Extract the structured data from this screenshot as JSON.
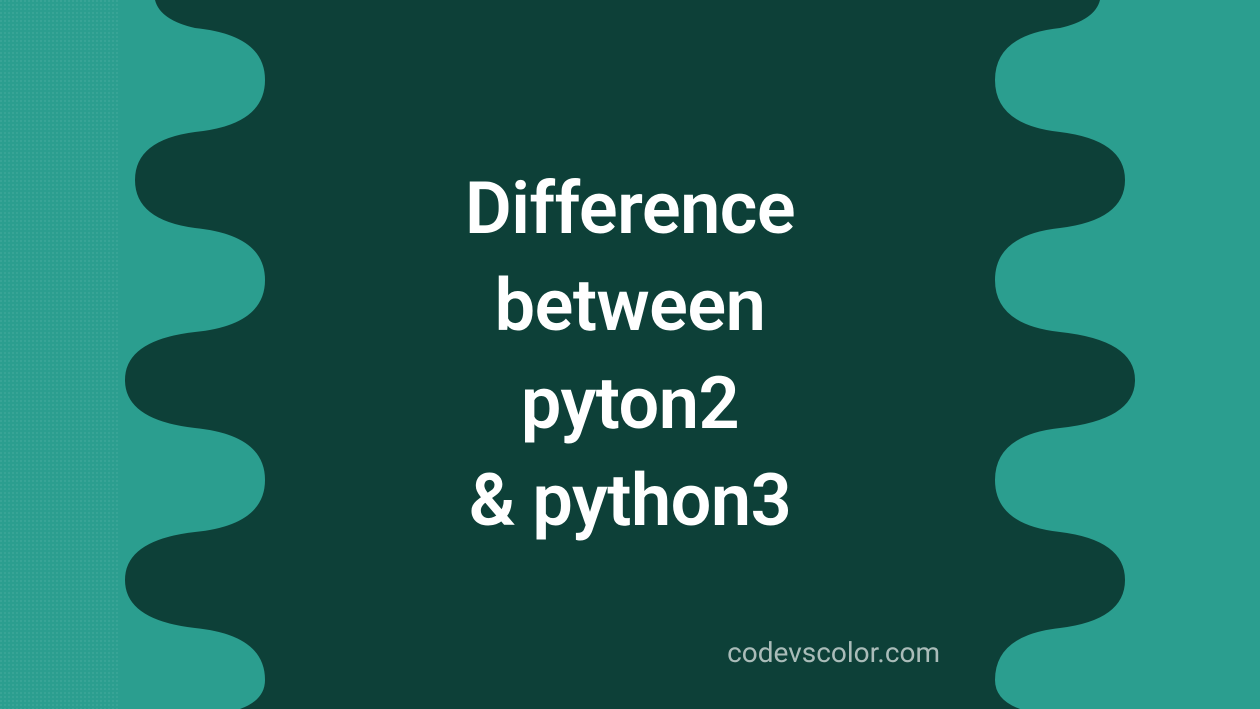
{
  "banner": {
    "title_line1": "Difference",
    "title_line2": "between",
    "title_line3": "pyton2",
    "title_line4": "& python3",
    "watermark": "codevscolor.com"
  },
  "colors": {
    "background_light": "#2b9e8f",
    "background_dark": "#0d4038",
    "text": "#ffffff"
  }
}
